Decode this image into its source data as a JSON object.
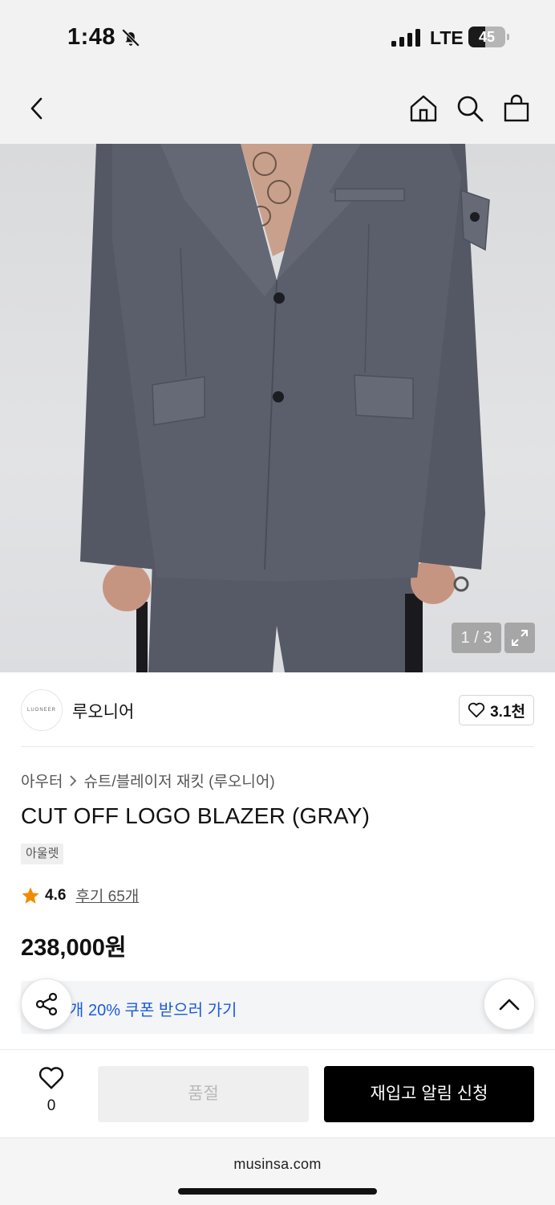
{
  "status_bar": {
    "time": "1:48",
    "network": "LTE",
    "battery": "45",
    "battery_level": 0.45
  },
  "nav": {
    "back_icon": "chevron-left-icon",
    "home_icon": "home-icon",
    "search_icon": "search-icon",
    "cart_icon": "bag-icon"
  },
  "gallery": {
    "counter": "1 / 3",
    "current": 1,
    "total": 3
  },
  "brand": {
    "logo_text": "LUONEER",
    "name": "루오니어",
    "likes": "3.1천"
  },
  "product": {
    "breadcrumb": [
      "아우터",
      "슈트/블레이저 재킷 (루오니어)"
    ],
    "title": "CUT OFF LOGO BLAZER (GRAY)",
    "tag": "아울렛",
    "rating": "4.6",
    "rating_value": 4.6,
    "review_link": "후기 65개",
    "price": "238,000원"
  },
  "coupon": {
    "text": "개 20% 쿠폰 받으러 가기",
    "accent": "#1c5bd9"
  },
  "bottom_bar": {
    "wish_count": "0",
    "soldout_label": "품절",
    "restock_label": "재입고 알림 신청"
  },
  "browser": {
    "url": "musinsa.com"
  },
  "colors": {
    "star": "#f08c00",
    "blazer": "#5a5e6b",
    "background": "#f2f2f2"
  }
}
